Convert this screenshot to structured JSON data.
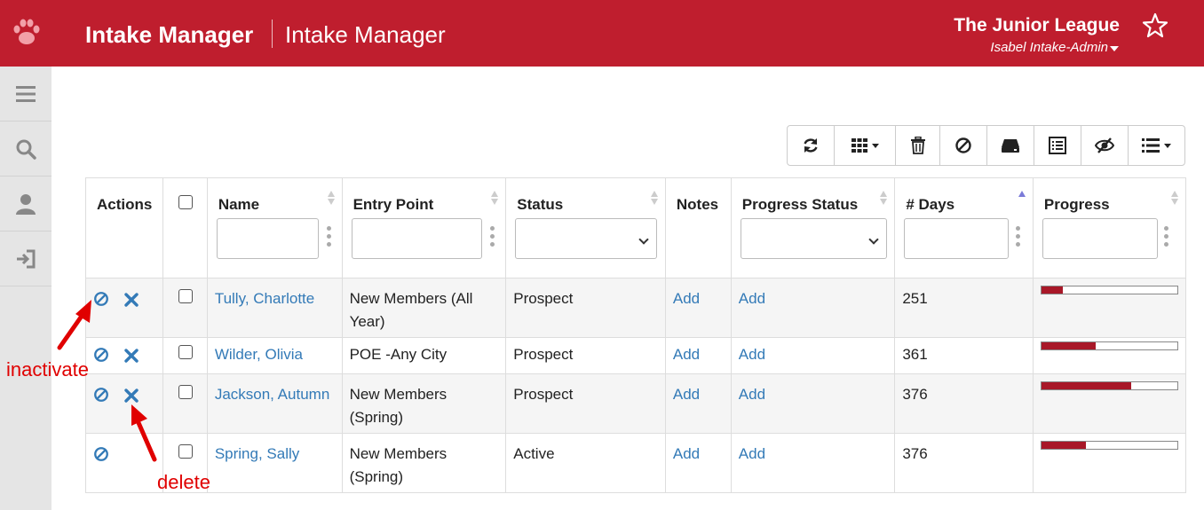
{
  "header": {
    "app_title": "Intake Manager",
    "app_subtitle": "Intake Manager",
    "org_name": "The Junior League",
    "user_name": "Isabel Intake-Admin",
    "brand_color": "#bf1e2e"
  },
  "sidebar": {
    "items": [
      {
        "icon": "hamburger-menu-icon"
      },
      {
        "icon": "search-icon"
      },
      {
        "icon": "user-icon"
      },
      {
        "icon": "sign-out-icon"
      }
    ]
  },
  "toolbar": {
    "buttons": [
      "refresh-icon",
      "columns-grid-icon",
      "trash-icon",
      "ban-icon",
      "hard-drive-icon",
      "list-alt-icon",
      "eye-slash-icon",
      "list-icon"
    ]
  },
  "table": {
    "headers": {
      "actions": "Actions",
      "name": "Name",
      "entry_point": "Entry Point",
      "status": "Status",
      "notes": "Notes",
      "progress_status": "Progress Status",
      "days": "# Days",
      "progress": "Progress"
    },
    "rows": [
      {
        "name": "Tully, Charlotte",
        "entry_point": "New Members (All Year)",
        "status": "Prospect",
        "notes": "Add",
        "progress_status": "Add",
        "days": "251",
        "progress": 0.16
      },
      {
        "name": "Wilder, Olivia",
        "entry_point": "POE -Any City",
        "status": "Prospect",
        "notes": "Add",
        "progress_status": "Add",
        "days": "361",
        "progress": 0.4
      },
      {
        "name": "Jackson, Autumn",
        "entry_point": "New Members (Spring)",
        "status": "Prospect",
        "notes": "Add",
        "progress_status": "Add",
        "days": "376",
        "progress": 0.66
      },
      {
        "name": "Spring, Sally",
        "entry_point": "New Members (Spring)",
        "status": "Active",
        "notes": "Add",
        "progress_status": "Add",
        "days": "376",
        "progress": 0.33
      }
    ]
  },
  "annotations": {
    "inactivate": "inactivate",
    "delete": "delete",
    "color": "#e00000"
  }
}
